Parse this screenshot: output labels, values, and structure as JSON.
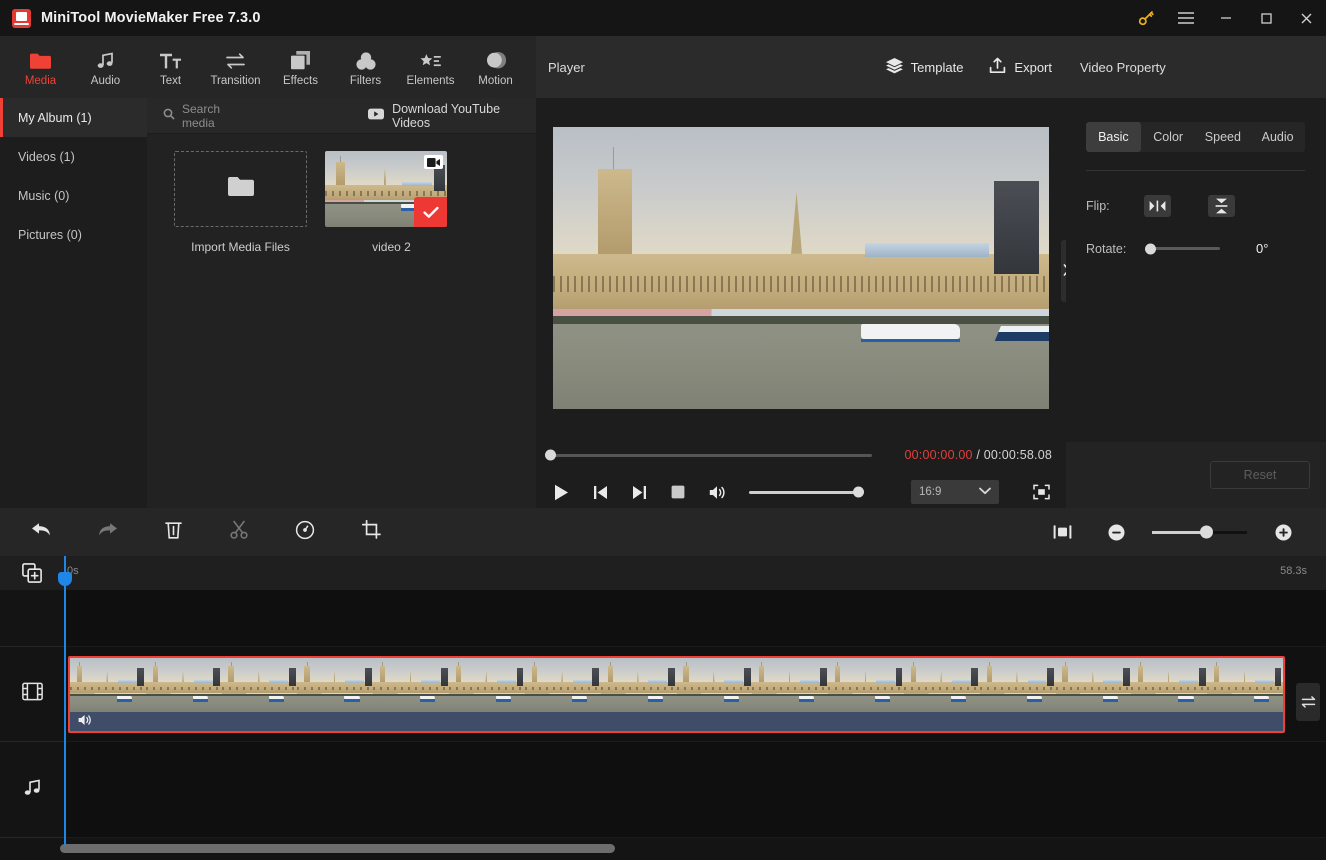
{
  "window": {
    "title": "MiniTool MovieMaker Free 7.3.0",
    "logo_name": "app-logo",
    "controls": {
      "key": "key-icon",
      "menu": "hamburger-menu-icon",
      "minimize": "minimize-icon",
      "maximize": "maximize-icon",
      "close": "close-icon"
    }
  },
  "topnav": {
    "items": [
      {
        "label": "Media",
        "icon": "folder-icon",
        "active": true
      },
      {
        "label": "Audio",
        "icon": "music-note-icon",
        "active": false
      },
      {
        "label": "Text",
        "icon": "text-icon",
        "active": false
      },
      {
        "label": "Transition",
        "icon": "transition-arrows-icon",
        "active": false
      },
      {
        "label": "Effects",
        "icon": "effects-squares-icon",
        "active": false
      },
      {
        "label": "Filters",
        "icon": "filters-circles-icon",
        "active": false
      },
      {
        "label": "Elements",
        "icon": "elements-star-list-icon",
        "active": false
      },
      {
        "label": "Motion",
        "icon": "motion-circle-icon",
        "active": false
      }
    ]
  },
  "library": {
    "albums": [
      {
        "label": "My Album (1)",
        "active": true
      },
      {
        "label": "Videos (1)",
        "active": false
      },
      {
        "label": "Music (0)",
        "active": false
      },
      {
        "label": "Pictures (0)",
        "active": false
      }
    ],
    "search_placeholder": "Search media",
    "download_youtube_label": "Download YouTube Videos",
    "import_label": "Import Media Files",
    "media_items": [
      {
        "name": "video 2",
        "selected": true,
        "type": "video"
      }
    ]
  },
  "player": {
    "title": "Player",
    "template_label": "Template",
    "export_label": "Export",
    "current_time": "00:00:00.00",
    "time_separator": "/",
    "total_time": "00:00:58.08",
    "aspect_ratio": "16:9",
    "progress_percent": 0,
    "volume_percent": 100,
    "controls": {
      "play": "play-icon",
      "prev_frame": "previous-frame-icon",
      "next_frame": "next-frame-icon",
      "stop": "stop-icon",
      "volume": "volume-icon",
      "fullscreen": "fullscreen-icon"
    }
  },
  "property_panel": {
    "title": "Video Property",
    "tabs": [
      {
        "label": "Basic",
        "active": true
      },
      {
        "label": "Color",
        "active": false
      },
      {
        "label": "Speed",
        "active": false
      },
      {
        "label": "Audio",
        "active": false
      }
    ],
    "flip_label": "Flip:",
    "flip_horizontal_icon": "flip-horizontal-icon",
    "flip_vertical_icon": "flip-vertical-icon",
    "rotate_label": "Rotate:",
    "rotate_value": "0°",
    "rotate_percent": 0,
    "reset_label": "Reset",
    "expander_icon": "chevron-right-icon"
  },
  "edit_toolbar": {
    "buttons": [
      {
        "name": "undo-button",
        "icon": "undo-arrow-icon",
        "enabled": true
      },
      {
        "name": "redo-button",
        "icon": "redo-arrow-icon",
        "enabled": false
      },
      {
        "name": "delete-button",
        "icon": "trash-icon",
        "enabled": true
      },
      {
        "name": "split-button",
        "icon": "scissors-icon",
        "enabled": false
      },
      {
        "name": "speed-button",
        "icon": "speedometer-icon",
        "enabled": true
      },
      {
        "name": "crop-button",
        "icon": "crop-icon",
        "enabled": true
      }
    ],
    "fit_icon": "fit-to-screen-icon",
    "zoom_out_icon": "zoom-out-icon",
    "zoom_in_icon": "zoom-in-icon",
    "zoom_percent": 50
  },
  "timeline": {
    "add_track_icon": "add-media-to-timeline-icon",
    "ruler_start": "0s",
    "ruler_end": "58.3s",
    "tracks": [
      {
        "name": "overlay-track",
        "icon": null
      },
      {
        "name": "video-track",
        "icon": "film-strip-icon"
      },
      {
        "name": "audio-track",
        "icon": "music-note-icon"
      }
    ],
    "clip": {
      "name": "video 2",
      "selected": true,
      "mute_icon": "speaker-icon"
    },
    "swap_icon": "swap-arrows-icon",
    "playhead_position": "0s"
  },
  "colors": {
    "accent_red": "#ef4136",
    "playhead_blue": "#1f86e8",
    "panel_bg": "#1d1d1d",
    "header_bg": "#2b2b2b",
    "clip_audio": "#3f4d68"
  }
}
